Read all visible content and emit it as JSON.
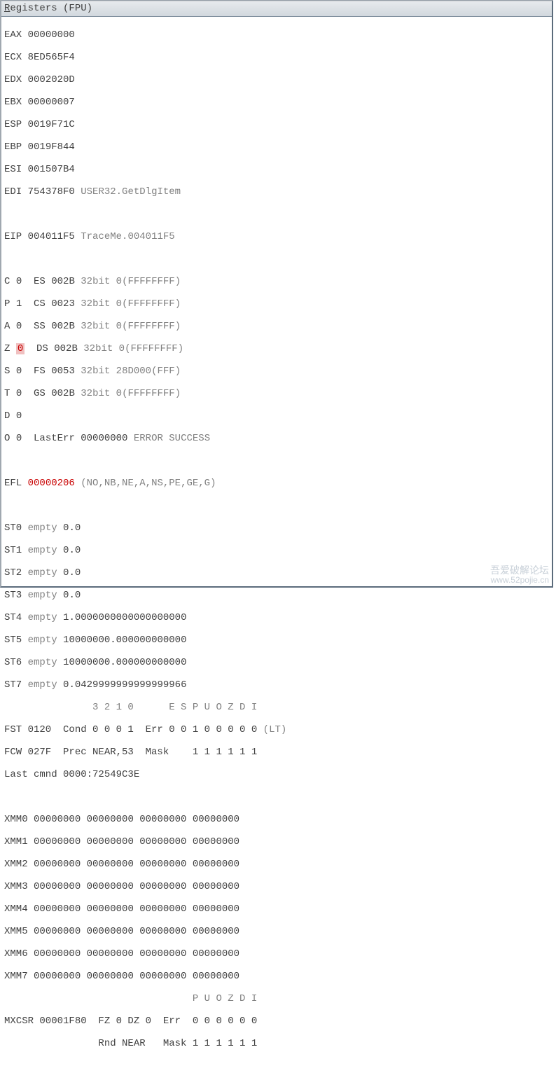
{
  "title": {
    "underlined": "R",
    "rest": "egisters (FPU)"
  },
  "gen": {
    "eax": {
      "name": "EAX",
      "val": "00000000"
    },
    "ecx": {
      "name": "ECX",
      "val": "8ED565F4"
    },
    "edx": {
      "name": "EDX",
      "val": "0002020D"
    },
    "ebx": {
      "name": "EBX",
      "val": "00000007"
    },
    "esp": {
      "name": "ESP",
      "val": "0019F71C"
    },
    "ebp": {
      "name": "EBP",
      "val": "0019F844"
    },
    "esi": {
      "name": "ESI",
      "val": "001507B4"
    },
    "edi": {
      "name": "EDI",
      "val": "754378F0",
      "sym": "USER32.GetDlgItem"
    },
    "eip": {
      "name": "EIP",
      "val": "004011F5",
      "sym": "TraceMe.004011F5"
    }
  },
  "flags": {
    "c": {
      "name": "C",
      "val": "0"
    },
    "p": {
      "name": "P",
      "val": "1"
    },
    "a": {
      "name": "A",
      "val": "0"
    },
    "z": {
      "name": "Z",
      "val": "0"
    },
    "s": {
      "name": "S",
      "val": "0"
    },
    "t": {
      "name": "T",
      "val": "0"
    },
    "d": {
      "name": "D",
      "val": "0"
    },
    "o": {
      "name": "O",
      "val": "0"
    }
  },
  "seg": {
    "es": {
      "name": "ES",
      "val": "002B",
      "info": "32bit 0(FFFFFFFF)"
    },
    "cs": {
      "name": "CS",
      "val": "0023",
      "info": "32bit 0(FFFFFFFF)"
    },
    "ss": {
      "name": "SS",
      "val": "002B",
      "info": "32bit 0(FFFFFFFF)"
    },
    "ds": {
      "name": "DS",
      "val": "002B",
      "info": "32bit 0(FFFFFFFF)"
    },
    "fs": {
      "name": "FS",
      "val": "0053",
      "info": "32bit 28D000(FFF)"
    },
    "gs": {
      "name": "GS",
      "val": "002B",
      "info": "32bit 0(FFFFFFFF)"
    }
  },
  "lasterr": {
    "label": "LastErr",
    "val": "00000000",
    "text": "ERROR SUCCESS"
  },
  "efl": {
    "name": "EFL",
    "val": "00000206",
    "flags": "(NO,NB,NE,A,NS,PE,GE,G)"
  },
  "fpu": {
    "st0": {
      "name": "ST0",
      "state": "empty",
      "val": "0.0"
    },
    "st1": {
      "name": "ST1",
      "state": "empty",
      "val": "0.0"
    },
    "st2": {
      "name": "ST2",
      "state": "empty",
      "val": "0.0"
    },
    "st3": {
      "name": "ST3",
      "state": "empty",
      "val": "0.0"
    },
    "st4": {
      "name": "ST4",
      "state": "empty",
      "val": "1.0000000000000000000"
    },
    "st5": {
      "name": "ST5",
      "state": "empty",
      "val": "10000000.000000000000"
    },
    "st6": {
      "name": "ST6",
      "state": "empty",
      "val": "10000000.000000000000"
    },
    "st7": {
      "name": "ST7",
      "state": "empty",
      "val": "0.0429999999999999966"
    },
    "header": "               3 2 1 0      E S P U O Z D I",
    "fst": {
      "line": "FST 0120  Cond 0 0 0 1  Err 0 0 1 0 0 0 0 0",
      "tag": "(LT)"
    },
    "fcw": "FCW 027F  Prec NEAR,53  Mask    1 1 1 1 1 1",
    "lastcmnd": "Last cmnd 0000:72549C3E"
  },
  "xmm": {
    "0": {
      "name": "XMM0",
      "val": "00000000 00000000 00000000 00000000"
    },
    "1": {
      "name": "XMM1",
      "val": "00000000 00000000 00000000 00000000"
    },
    "2": {
      "name": "XMM2",
      "val": "00000000 00000000 00000000 00000000"
    },
    "3": {
      "name": "XMM3",
      "val": "00000000 00000000 00000000 00000000"
    },
    "4": {
      "name": "XMM4",
      "val": "00000000 00000000 00000000 00000000"
    },
    "5": {
      "name": "XMM5",
      "val": "00000000 00000000 00000000 00000000"
    },
    "6": {
      "name": "XMM6",
      "val": "00000000 00000000 00000000 00000000"
    },
    "7": {
      "name": "XMM7",
      "val": "00000000 00000000 00000000 00000000"
    }
  },
  "mxcsr": {
    "header": "                                P U O Z D I",
    "line1": "MXCSR 00001F80  FZ 0 DZ 0  Err  0 0 0 0 0 0",
    "line2": "                Rnd NEAR   Mask 1 1 1 1 1 1"
  },
  "watermark": {
    "line1": "吾爱破解论坛",
    "line2": "www.52pojie.cn"
  }
}
